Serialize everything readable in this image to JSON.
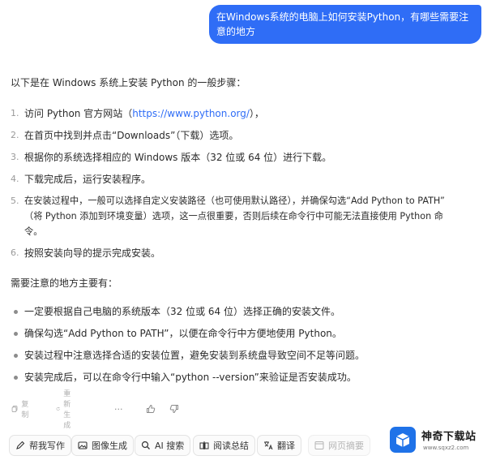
{
  "user_message": "在Windows系统的电脑上如何安装Python，有哪些需要注意的地方",
  "answer": {
    "intro": "以下是在 Windows 系统上安装 Python 的一般步骤：",
    "steps": [
      {
        "num": "1.",
        "before": "访问 Python 官方网站（",
        "link": "https://www.python.org/",
        "after": "），"
      },
      {
        "num": "2.",
        "text": "在首页中找到并点击“Downloads”（下载）选项。"
      },
      {
        "num": "3.",
        "text": "根据你的系统选择相应的 Windows 版本（32 位或 64 位）进行下载。"
      },
      {
        "num": "4.",
        "text": "下载完成后，运行安装程序。"
      },
      {
        "num": "5.",
        "line1": "在安装过程中，一般可以选择自定义安装路径（也可使用默认路径），并确保勾选“Add Python to PATH”",
        "line2": "（将 Python 添加到环境变量）选项，这一点很重要，否则后续在命令行中可能无法直接使用 Python 命",
        "line3": "令。"
      },
      {
        "num": "6.",
        "text": "按照安装向导的提示完成安装。"
      }
    ],
    "notes_title": "需要注意的地方主要有：",
    "notes": [
      "一定要根据自己电脑的系统版本（32 位或 64 位）选择正确的安装文件。",
      "确保勾选“Add Python to PATH”，以便在命令行中方便地使用 Python。",
      "安装过程中注意选择合适的安装位置，避免安装到系统盘导致空间不足等问题。",
      "安装完成后，可以在命令行中输入“python --version”来验证是否安装成功。"
    ]
  },
  "actions": {
    "copy": "复制",
    "regenerate": "重新生成",
    "more": "···"
  },
  "toolbar": [
    {
      "label": "帮我写作",
      "icon": "pen-icon"
    },
    {
      "label": "图像生成",
      "icon": "image-icon"
    },
    {
      "label": "AI 搜索",
      "icon": "search-icon"
    },
    {
      "label": "阅读总结",
      "icon": "read-icon"
    },
    {
      "label": "翻译",
      "icon": "translate-icon"
    },
    {
      "label": "网页摘要",
      "icon": "webpage-icon"
    }
  ],
  "watermark": {
    "title": "神奇下载站",
    "url": "www.sqxz2.com",
    "brand_color": "#1f72e8"
  },
  "colors": {
    "user_bubble": "#2f6df6",
    "link": "#2f6df6"
  }
}
